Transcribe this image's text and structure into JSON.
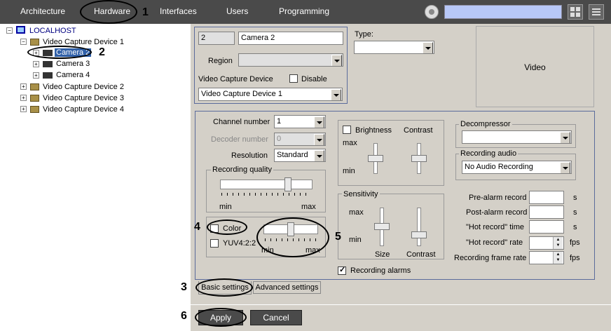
{
  "topbar": {
    "tabs": [
      "Architecture",
      "Hardware",
      "Interfaces",
      "Users",
      "Programming"
    ],
    "search_value": ""
  },
  "annotations": [
    "1",
    "2",
    "3",
    "4",
    "5",
    "6"
  ],
  "tree": {
    "root": "LOCALHOST",
    "device1": "Video Capture Device 1",
    "cameras": [
      "Camera 2",
      "Camera 3",
      "Camera 4"
    ],
    "devices": [
      "Video Capture Device 2",
      "Video Capture Device 3",
      "Video Capture Device 4"
    ]
  },
  "header": {
    "id_value": "2",
    "name_value": "Camera 2",
    "region_label": "Region",
    "region_value": "",
    "vcd_label": "Video Capture Device",
    "disable_label": "Disable",
    "vcd_value": "Video Capture Device 1",
    "type_label": "Type:",
    "type_value": "",
    "video_label": "Video"
  },
  "settings": {
    "channel_label": "Channel number",
    "channel_value": "1",
    "decoder_label": "Decoder number",
    "decoder_value": "0",
    "resolution_label": "Resolution",
    "resolution_value": "Standard",
    "rq_title": "Recording quality",
    "min": "min",
    "max": "max",
    "color_label": "Color",
    "yuv_label": "YUV4:2:2",
    "brightness_label": "Brightness",
    "contrast_label": "Contrast",
    "sensitivity_title": "Sensitivity",
    "size_label": "Size",
    "recording_alarms_label": "Recording alarms",
    "decompressor_title": "Decompressor",
    "decompressor_value": "",
    "recording_audio_title": "Recording audio",
    "audio_value": "No Audio Recording",
    "prealarm_label": "Pre-alarm record",
    "postalarm_label": "Post-alarm record",
    "hot_time_label": "\"Hot record\" time",
    "hot_rate_label": "\"Hot record\" rate",
    "frame_rate_label": "Recording frame rate",
    "unit_s": "s",
    "unit_fps": "fps"
  },
  "tabs": {
    "basic": "Basic settings",
    "advanced": "Advanced settings"
  },
  "buttons": {
    "apply": "Apply",
    "cancel": "Cancel"
  },
  "colors": {
    "topbar": "#4a4a4a",
    "panel": "#d4d0c8",
    "search": "#b8c8f8",
    "tree_root": "#000080"
  }
}
